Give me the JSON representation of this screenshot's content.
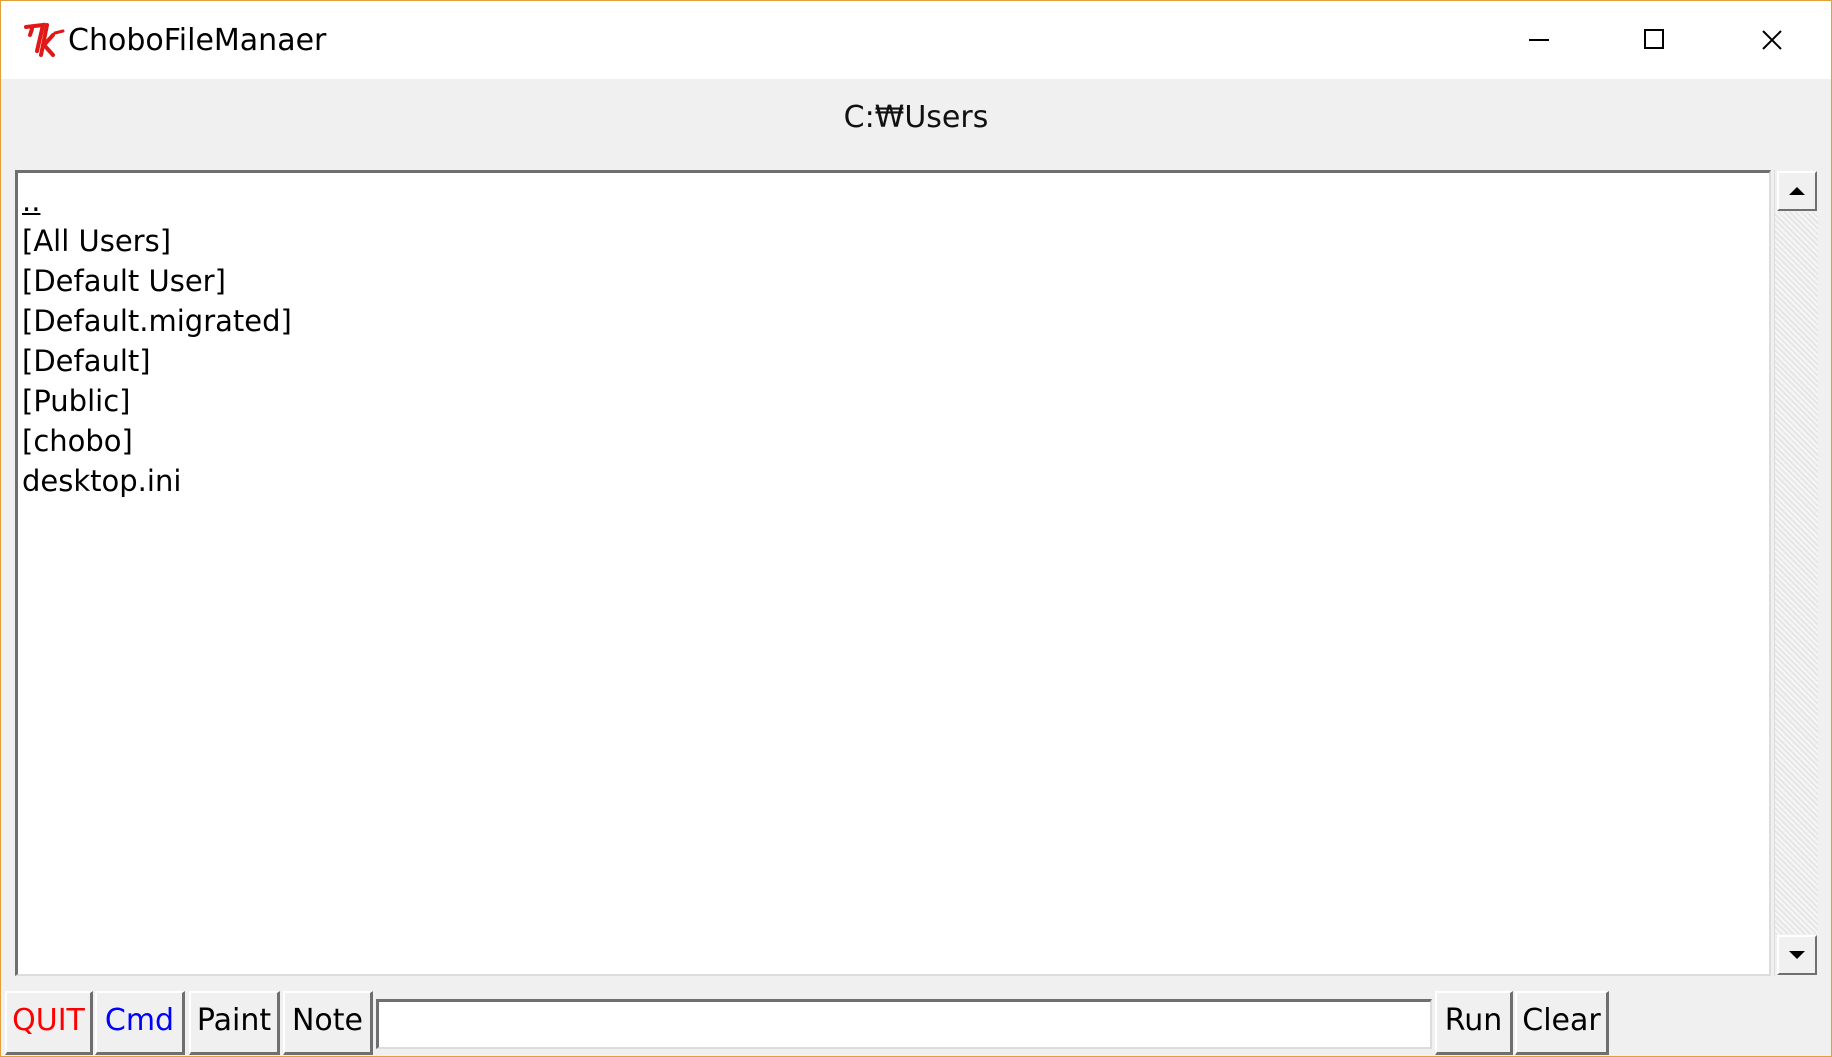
{
  "window": {
    "title": "ChoboFileManaer",
    "icon": "tk-logo-icon",
    "controls": {
      "minimize": "minimize-icon",
      "maximize": "maximize-icon",
      "close": "close-icon"
    }
  },
  "path": {
    "current": "C:₩Users"
  },
  "files": {
    "items": [
      "..",
      "[All Users]",
      "[Default User]",
      "[Default.migrated]",
      "[Default]",
      "[Public]",
      "[chobo]",
      "desktop.ini"
    ],
    "active_index": 0
  },
  "scrollbar": {
    "up": "arrow-up-icon",
    "down": "arrow-down-icon"
  },
  "toolbar": {
    "quit_label": "QUIT",
    "quit_color": "#ff0000",
    "cmd_label": "Cmd",
    "cmd_color": "#0000ff",
    "paint_label": "Paint",
    "note_label": "Note",
    "command_value": "",
    "run_label": "Run",
    "clear_label": "Clear"
  }
}
